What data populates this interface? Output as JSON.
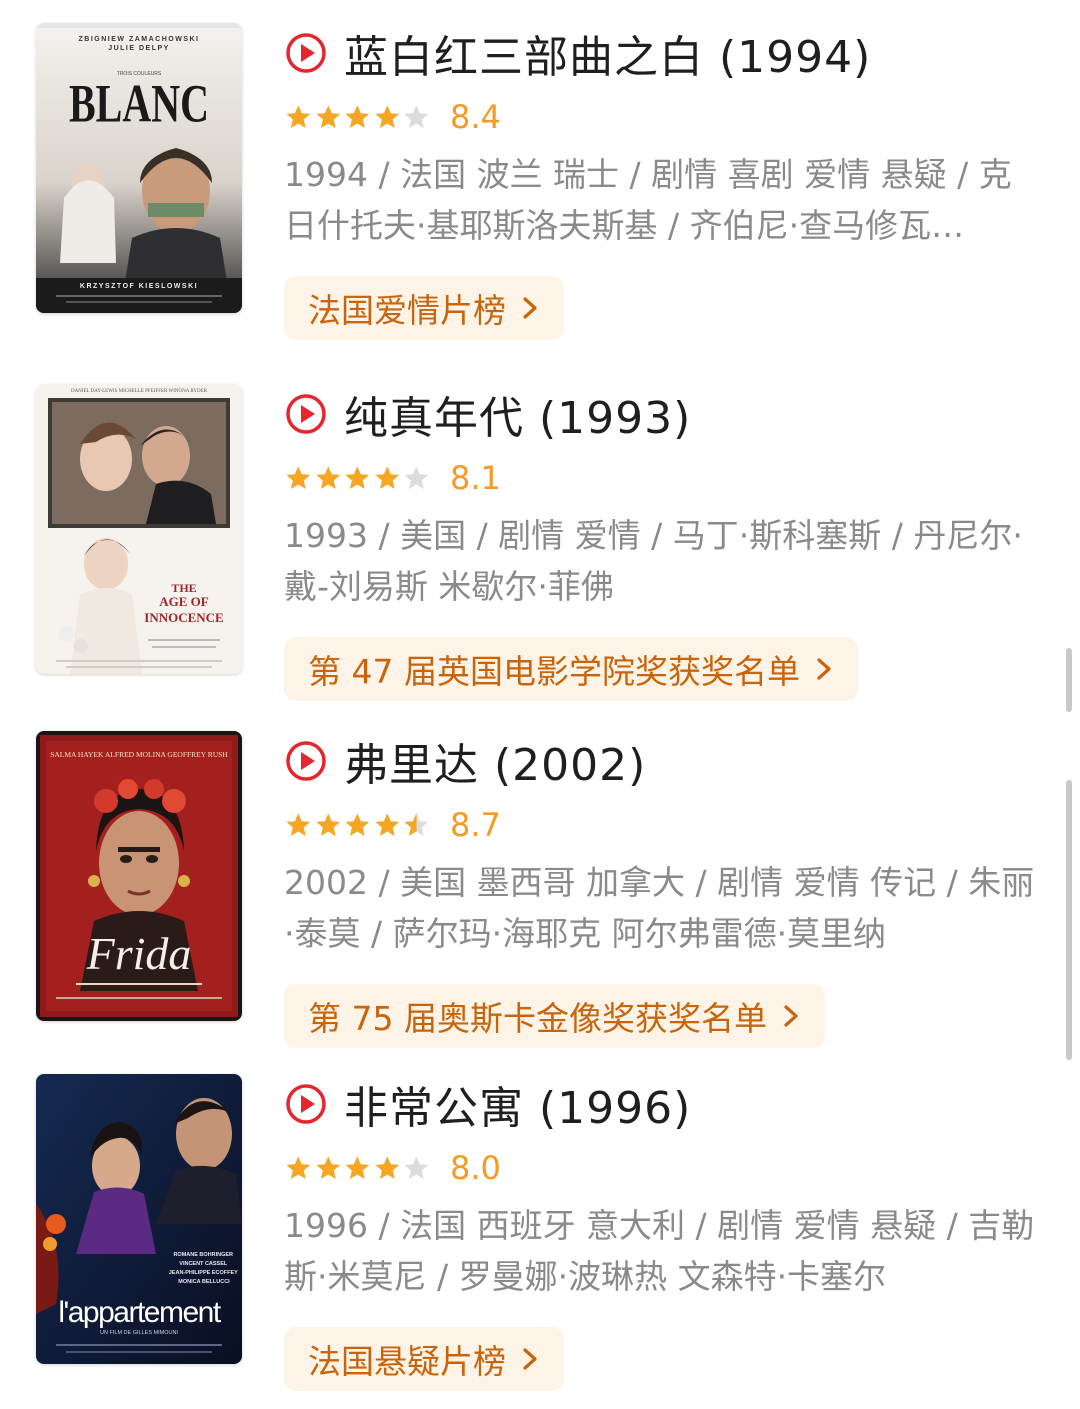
{
  "movies": [
    {
      "title": "蓝白红三部曲之白 (1994)",
      "rating": 8.4,
      "rating_text": "8.4",
      "stars": [
        1,
        1,
        1,
        1,
        0
      ],
      "meta": "1994 / 法国 波兰 瑞士 / 剧情 喜剧 爱情 悬疑 / 克日什托夫·基耶斯洛夫斯基 / 齐伯尼·查马修瓦…",
      "chart_label": "法国爱情片榜",
      "poster": {
        "credits_top": "ZBIGNIEW ZAMACHOWSKI",
        "credits_top2": "JULIE DELPY",
        "small": "TROIS COULEURS",
        "title": "BLANC",
        "credits_bottom": "KRZYSZTOF KIESLOWSKI"
      }
    },
    {
      "title": "纯真年代 (1993)",
      "rating": 8.1,
      "rating_text": "8.1",
      "stars": [
        1,
        1,
        1,
        1,
        0
      ],
      "meta": "1993 / 美国 / 剧情 爱情 / 马丁·斯科塞斯 / 丹尼尔·戴-刘易斯 米歇尔·菲佛",
      "chart_label": "第 47 届英国电影学院奖获奖名单",
      "poster": {
        "credits_top": "DANIEL DAY-LEWIS   MICHELLE PFEIFFER   WINONA RYDER",
        "title_line1": "THE",
        "title_line2": "AGE OF",
        "title_line3": "INNOCENCE"
      }
    },
    {
      "title": "弗里达 (2002)",
      "rating": 8.7,
      "rating_text": "8.7",
      "stars": [
        1,
        1,
        1,
        1,
        0.5
      ],
      "meta": "2002 / 美国 墨西哥 加拿大 / 剧情 爱情 传记 / 朱丽·泰莫 / 萨尔玛·海耶克 阿尔弗雷德·莫里纳",
      "chart_label": "第 75 届奥斯卡金像奖获奖名单",
      "poster": {
        "credits_top": "SALMA HAYEK  ALFRED MOLINA  GEOFFREY RUSH",
        "title": "Frida"
      }
    },
    {
      "title": "非常公寓 (1996)",
      "rating": 8.0,
      "rating_text": "8.0",
      "stars": [
        1,
        1,
        1,
        1,
        0
      ],
      "meta": "1996 / 法国 西班牙 意大利 / 剧情 爱情 悬疑 / 吉勒斯·米莫尼 / 罗曼娜·波琳热 文森特·卡塞尔",
      "chart_label": "法国悬疑片榜",
      "poster": {
        "credits": "ROMANE BOHRINGER\nVINCENT CASSEL\nJEAN-PHILIPPE ECOFFEY\nMONICA BELLUCCI",
        "title": "l'appartement",
        "subtitle": "UN FILM DE GILLES MIMOUNI"
      }
    }
  ],
  "colors": {
    "accent_red": "#e6252c",
    "star_orange": "#f5a623",
    "star_grey": "#dcdcdc",
    "score_orange": "#f59a23",
    "tag_bg": "#fdf3e6",
    "tag_text": "#c8650c"
  },
  "icons": {
    "play": "play-circle-icon",
    "star": "star-icon",
    "chevron": "chevron-right-icon"
  }
}
